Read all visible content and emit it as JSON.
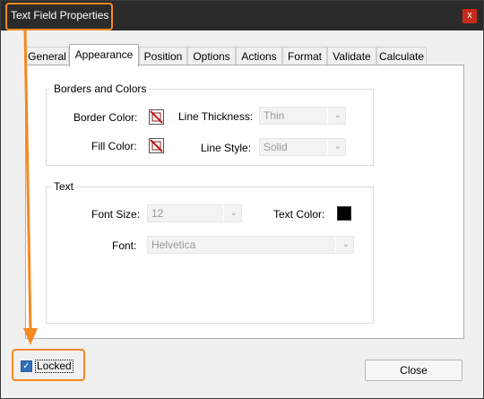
{
  "window": {
    "title": "Text Field Properties",
    "close_glyph": "x"
  },
  "tabs": [
    {
      "label": "General",
      "active": false
    },
    {
      "label": "Appearance",
      "active": true
    },
    {
      "label": "Position",
      "active": false
    },
    {
      "label": "Options",
      "active": false
    },
    {
      "label": "Actions",
      "active": false
    },
    {
      "label": "Format",
      "active": false
    },
    {
      "label": "Validate",
      "active": false
    },
    {
      "label": "Calculate",
      "active": false
    }
  ],
  "borders_and_colors": {
    "title": "Borders and Colors",
    "border_color_label": "Border Color:",
    "fill_color_label": "Fill Color:",
    "line_thickness_label": "Line Thickness:",
    "line_thickness_value": "Thin",
    "line_style_label": "Line Style:",
    "line_style_value": "Solid"
  },
  "text_group": {
    "title": "Text",
    "font_size_label": "Font Size:",
    "font_size_value": "12",
    "text_color_label": "Text Color:",
    "text_color": "#000000",
    "font_label": "Font:",
    "font_value": "Helvetica"
  },
  "footer": {
    "locked_label": "Locked",
    "locked_checked": true,
    "check_glyph": "✓",
    "close_label": "Close"
  },
  "icons": {
    "chevron": "⌄"
  },
  "colors": {
    "highlight": "#f5891f",
    "titlebar": "#2b2b2b",
    "checkbox": "#2f6fb8"
  }
}
